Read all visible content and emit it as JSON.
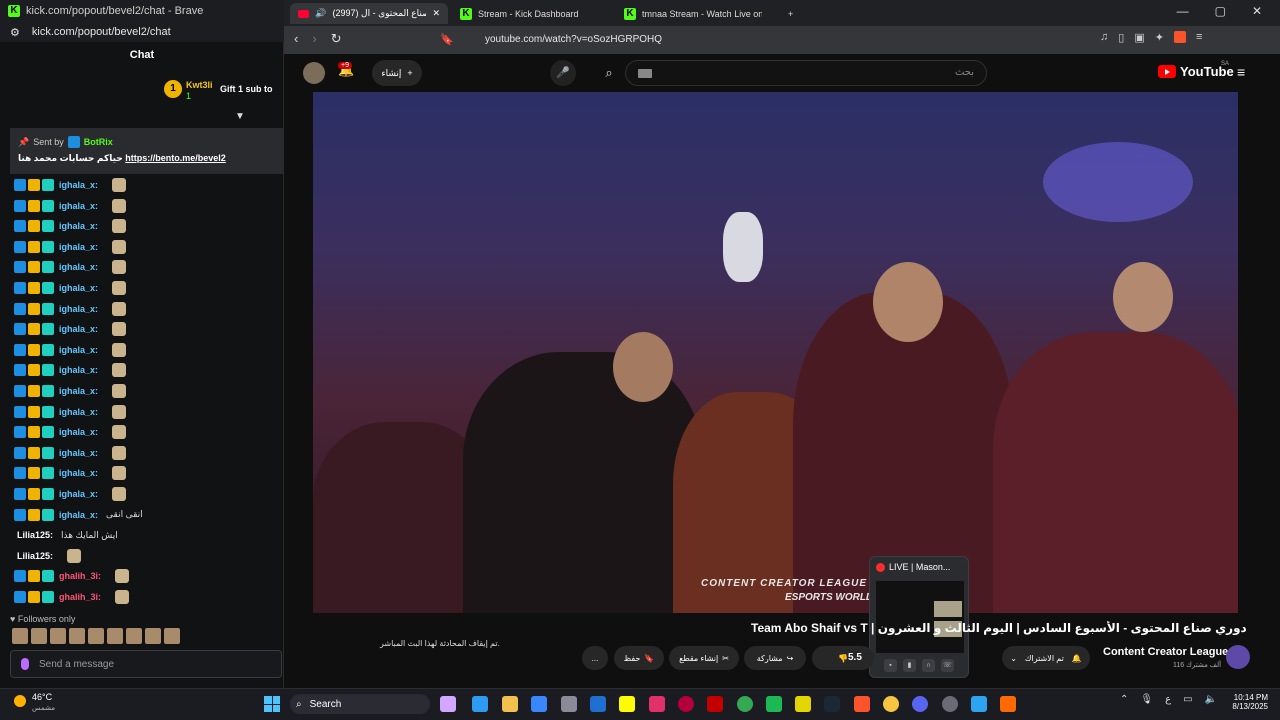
{
  "chat_window": {
    "title": "kick.com/popout/bevel2/chat - Brave",
    "url": "kick.com/popout/bevel2/chat",
    "header": "Chat",
    "gift": {
      "rank": "1",
      "user": "Kwt3li",
      "count": "1",
      "text": "Gift 1 sub to"
    },
    "pinned": {
      "sent_by": "Sent by",
      "bot_name": "BotRix",
      "message_prefix": "حياكم حسابات محمد هنا",
      "link": "https://bento.me/bevel2"
    },
    "messages": [
      {
        "user": "ighala_x:",
        "text": "",
        "badges": 3,
        "color": "blue",
        "emote": true
      },
      {
        "user": "ighala_x:",
        "text": "",
        "badges": 3,
        "color": "blue",
        "emote": true
      },
      {
        "user": "ighala_x:",
        "text": "",
        "badges": 3,
        "color": "blue",
        "emote": true
      },
      {
        "user": "ighala_x:",
        "text": "",
        "badges": 3,
        "color": "blue",
        "emote": true
      },
      {
        "user": "ighala_x:",
        "text": "",
        "badges": 3,
        "color": "blue",
        "emote": true
      },
      {
        "user": "ighala_x:",
        "text": "",
        "badges": 3,
        "color": "blue",
        "emote": true
      },
      {
        "user": "ighala_x:",
        "text": "",
        "badges": 3,
        "color": "blue",
        "emote": true
      },
      {
        "user": "ighala_x:",
        "text": "",
        "badges": 3,
        "color": "blue",
        "emote": true
      },
      {
        "user": "ighala_x:",
        "text": "",
        "badges": 3,
        "color": "blue",
        "emote": true
      },
      {
        "user": "ighala_x:",
        "text": "",
        "badges": 3,
        "color": "blue",
        "emote": true
      },
      {
        "user": "ighala_x:",
        "text": "",
        "badges": 3,
        "color": "blue",
        "emote": true
      },
      {
        "user": "ighala_x:",
        "text": "",
        "badges": 3,
        "color": "blue",
        "emote": true
      },
      {
        "user": "ighala_x:",
        "text": "",
        "badges": 3,
        "color": "blue",
        "emote": true
      },
      {
        "user": "ighala_x:",
        "text": "",
        "badges": 3,
        "color": "blue",
        "emote": true
      },
      {
        "user": "ighala_x:",
        "text": "",
        "badges": 3,
        "color": "blue",
        "emote": true
      },
      {
        "user": "ighala_x:",
        "text": "",
        "badges": 3,
        "color": "blue",
        "emote": true
      },
      {
        "user": "ighala_x:",
        "text": "انقى انقى",
        "badges": 3,
        "color": "blue",
        "emote": false
      },
      {
        "user": "Lilia125:",
        "text": "ايش المايك هذا",
        "badges": 0,
        "color": "white",
        "emote": false
      },
      {
        "user": "Lilia125:",
        "text": "",
        "badges": 0,
        "color": "white",
        "emote": true
      },
      {
        "user": "ghalih_3i:",
        "text": "",
        "badges": 3,
        "color": "red",
        "emote": true
      },
      {
        "user": "ghalih_3i:",
        "text": "",
        "badges": 3,
        "color": "red",
        "emote": true
      },
      {
        "user": "ghalih_3i:",
        "text": "انقى",
        "badges": 3,
        "color": "red",
        "emote": false
      }
    ],
    "followers_only": "Followers only",
    "send_placeholder": "Send a message"
  },
  "browser": {
    "tabs": [
      {
        "label": "(2997) دوري صناع المحتوى - ال",
        "active": true
      },
      {
        "label": "Stream - Kick Dashboard",
        "active": false
      },
      {
        "label": "tmnaa Stream - Watch Live on Ki",
        "active": false
      }
    ],
    "new_tab": "+",
    "url": "youtube.com/watch?v=oSozHGRPOHQ",
    "controls": {
      "minimize": "—",
      "maximize": "▢",
      "close": "✕"
    }
  },
  "youtube": {
    "logo_text": "YouTube",
    "region": "SA",
    "search_placeholder": "بحث",
    "create_label": "إنشاء",
    "notifications": "+9",
    "video_title": "دوري صناع المحتوى - الأسبوع السادس | اليوم الثالث و العشرون | Team Abo Shaif vs T",
    "channel": "Content Creator League",
    "subscribers": "116 ألف مشترك",
    "subscribed_label": "تم الاشتراك",
    "likes": "5.5",
    "share_label": "مشاركة",
    "clip_label": "إنشاء مقطع",
    "save_label": "حفظ",
    "more_label": "...",
    "chat_closed": "تم إيقاف المحادثة لهذا البث المباشر.",
    "watermark_left": "CONTENT CREATOR LEAGUE",
    "watermark_right": "ESPORTS WORLD CUP"
  },
  "pip": {
    "title": "LIVE | Mason..."
  },
  "taskbar": {
    "temp": "46°C",
    "weather_desc": "مشمس",
    "search_label": "Search",
    "lang": "ع",
    "time": "10:14 PM",
    "date": "8/13/2025"
  }
}
